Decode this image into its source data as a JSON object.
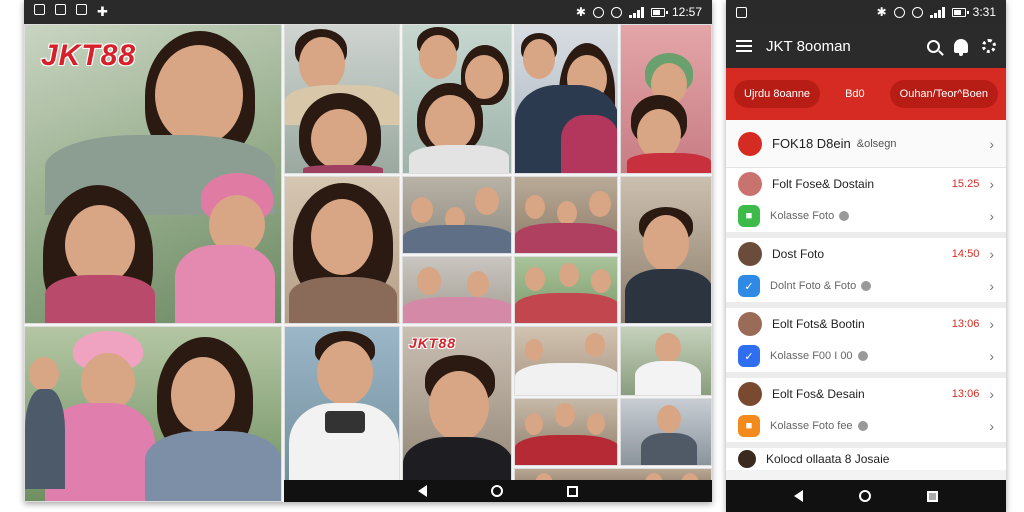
{
  "left_phone": {
    "status_time": "12:57",
    "logo_main": "JKT88",
    "logo_small": "JKT88"
  },
  "right_phone": {
    "status_time": "3:31",
    "app_title": "JKT 8ooman",
    "tabs": [
      "Ujrdu 8oanne",
      "Bd0",
      "Ouhan/Teor^Boen"
    ],
    "header_row": {
      "title": "FOK18 D8ein",
      "subtitle": "&olsegn"
    },
    "items": [
      {
        "title": "Folt Fose& Dostain",
        "number": "15.25",
        "sub": "Kolasse Foto",
        "avatar_color": "#c8736d",
        "badge_color": "#3cba4a"
      },
      {
        "title": "Dost Foto",
        "number": "14:50",
        "sub": "Dolnt Foto & Foto",
        "avatar_color": "#6b4c3b",
        "badge_color": "#2f8ae6"
      },
      {
        "title": "Eolt Fots& Bootin",
        "number": "13:06",
        "sub": "Kolasse F00 I 00",
        "avatar_color": "#9a6b57",
        "badge_color": "#2f6ef0"
      },
      {
        "title": "Eolt Fos& Desain",
        "number": "13:06",
        "sub": "Kolasse Foto fee",
        "avatar_color": "#7a4a30",
        "badge_color": "#f28a1d"
      }
    ],
    "last_row": "Kolocd ollaata 8 Josaie"
  }
}
